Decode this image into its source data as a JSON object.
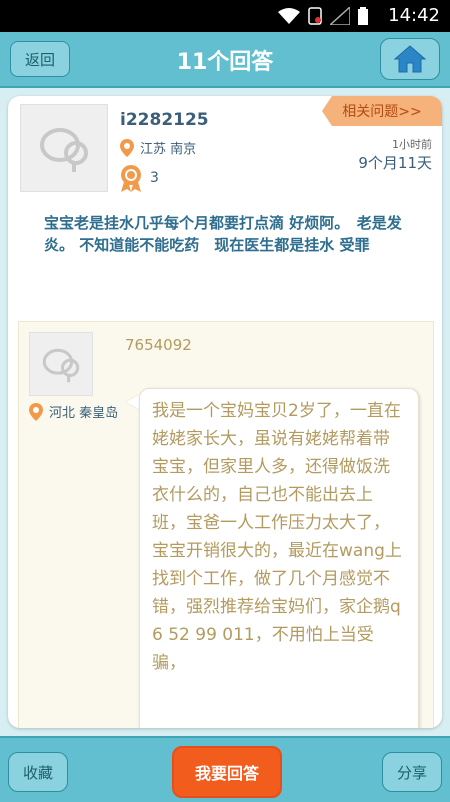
{
  "status": {
    "time": "14:42"
  },
  "nav": {
    "back": "返回",
    "title": "11个回答"
  },
  "question": {
    "username": "i2282125",
    "location": "江苏 南京",
    "rank": "3",
    "related": "相关问题>>",
    "time_ago": "1小时前",
    "child_age": "9个月11天",
    "text": "宝宝老是挂水几乎每个月都要打点滴 好烦阿。　老是发炎。 不知道能不能吃药　现在医生都是挂水 受罪"
  },
  "answer": {
    "username": "7654092",
    "location": "河北 秦皇岛",
    "text": "我是一个宝妈宝贝2岁了，一直在姥姥家长大，虽说有姥姥帮着带宝宝，但家里人多，还得做饭洗衣什么的，自己也不能出去上班，宝爸一人工作压力太大了，宝宝开销很大的，最近在wang上找到个工作，做了几个月感觉不错，强烈推荐给宝妈们，家企鹅q6 52 99 011，不用怕上当受骗，"
  },
  "bottom": {
    "favorite": "收藏",
    "answer": "我要回答",
    "share": "分享"
  },
  "colors": {
    "primary": "#62bfd0",
    "accent": "#f25d1e",
    "answer_text": "#b39b60"
  }
}
